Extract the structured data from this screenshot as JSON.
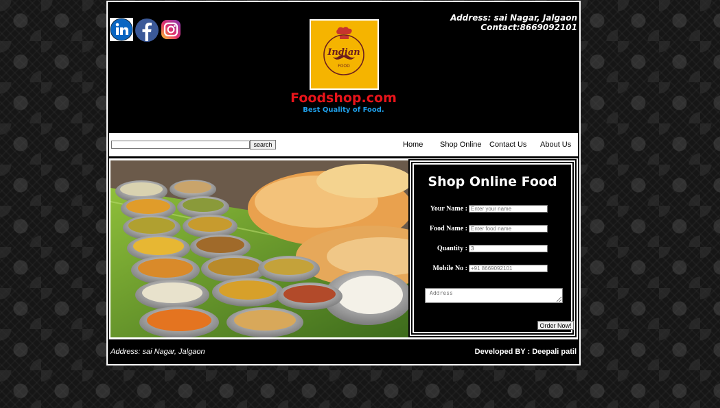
{
  "header": {
    "address": "Address: sai Nagar, Jalgaon",
    "contact": "Contact:8669092101",
    "brand": "Foodshop.com",
    "tagline": "Best Quality of Food.",
    "logo_text": "Indian",
    "logo_subtext": "FOOD"
  },
  "social_icons": [
    "linkedin-icon",
    "facebook-icon",
    "instagram-icon"
  ],
  "nav": {
    "search_value": "",
    "search_button": "search",
    "links": [
      "Home",
      "Shop Online",
      "Contact Us",
      "About Us"
    ]
  },
  "order_form": {
    "title": "Shop Online Food",
    "fields": [
      {
        "label": "Your Name :",
        "value": "",
        "placeholder": "Enter your name"
      },
      {
        "label": "Food Name :",
        "value": "",
        "placeholder": "Enter food name"
      },
      {
        "label": "Quantity :",
        "value": "3",
        "placeholder": ""
      },
      {
        "label": "Mobile No :",
        "value": "",
        "placeholder": "+91 8669092101"
      }
    ],
    "address_placeholder": "Address",
    "submit_label": "Order Now!"
  },
  "footer": {
    "address": "Address: sai Nagar, Jalgaon",
    "developer": "Developed BY : Deepali patil"
  },
  "colors": {
    "brand_red": "#e8141a",
    "tagline_blue": "#1fa0ea",
    "logo_yellow": "#f5b400"
  }
}
